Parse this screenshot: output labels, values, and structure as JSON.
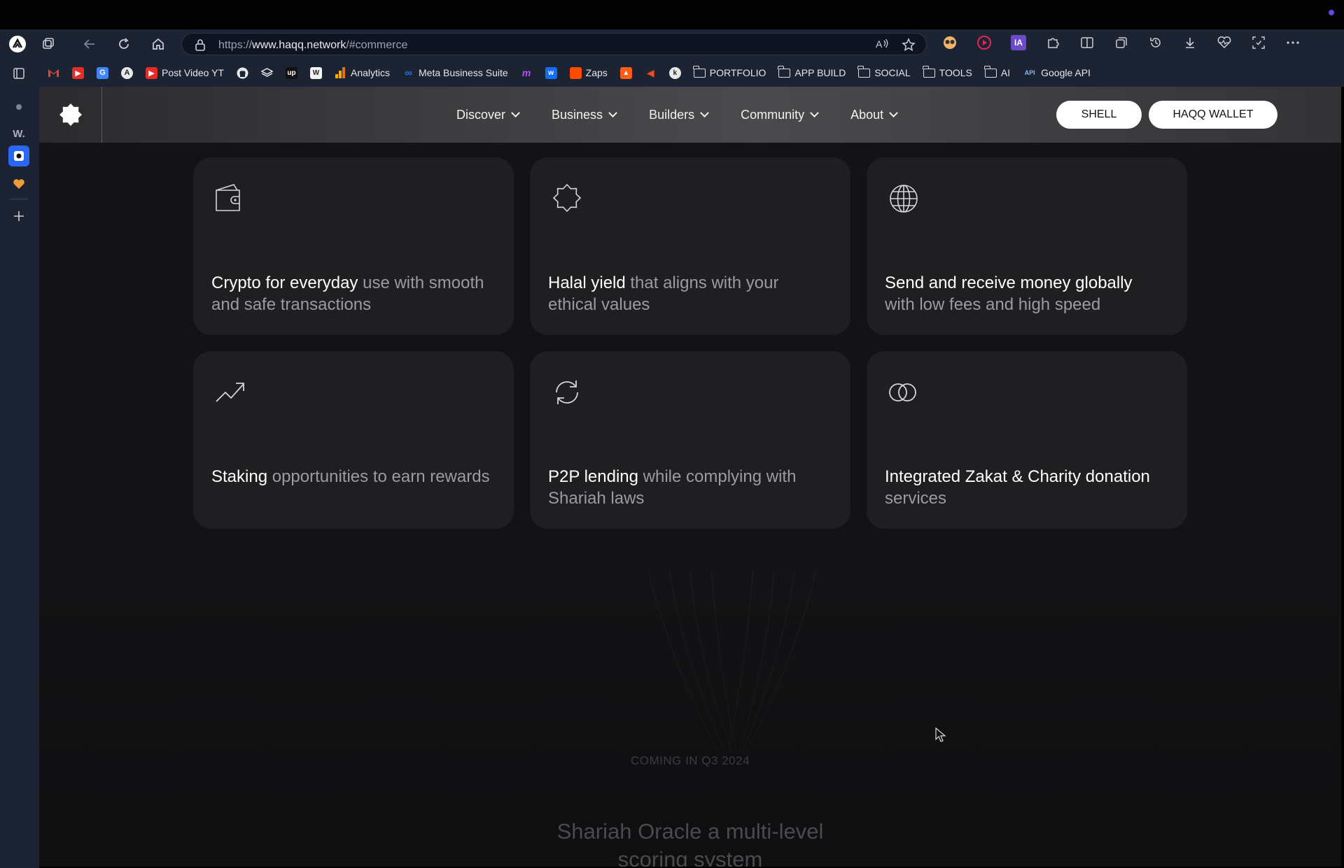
{
  "browser": {
    "url_prefix": "https://",
    "url_host": "www.haqq.network",
    "url_path": "/#commerce",
    "bookmarks": [
      {
        "label": "",
        "icon": "gmail-icon"
      },
      {
        "label": "",
        "icon": "youtube-icon"
      },
      {
        "label": "",
        "icon": "google-ads-icon"
      },
      {
        "label": "",
        "icon": "arc-icon"
      },
      {
        "label": "Post Video YT",
        "icon": "youtube-icon"
      },
      {
        "label": "",
        "icon": "github-icon"
      },
      {
        "label": "",
        "icon": "stack-icon"
      },
      {
        "label": "",
        "icon": "upwork-icon"
      },
      {
        "label": "",
        "icon": "w-icon"
      },
      {
        "label": "Analytics",
        "icon": "analytics-icon"
      },
      {
        "label": "Meta Business Suite",
        "icon": "meta-icon"
      },
      {
        "label": "",
        "icon": "make-icon"
      },
      {
        "label": "",
        "icon": "webflow-icon"
      },
      {
        "label": "Zaps",
        "icon": "zapier-icon"
      },
      {
        "label": "",
        "icon": "hostinger-icon"
      },
      {
        "label": "",
        "icon": "elementor-icon"
      },
      {
        "label": "",
        "icon": "plugin-icon"
      },
      {
        "label": "PORTFOLIO",
        "icon": "folder-icon"
      },
      {
        "label": "APP BUILD",
        "icon": "folder-icon"
      },
      {
        "label": "SOCIAL",
        "icon": "folder-icon"
      },
      {
        "label": "TOOLS",
        "icon": "folder-icon"
      },
      {
        "label": "AI",
        "icon": "folder-icon"
      },
      {
        "label": "Google API",
        "icon": "api-icon"
      }
    ],
    "sidebar": {
      "w_label": "W."
    }
  },
  "site": {
    "nav": [
      {
        "label": "Discover"
      },
      {
        "label": "Business"
      },
      {
        "label": "Builders"
      },
      {
        "label": "Community"
      },
      {
        "label": "About"
      }
    ],
    "shell_button": "SHELL",
    "wallet_button": "HAQQ WALLET"
  },
  "features": [
    {
      "highlight": "Crypto for everyday",
      "rest": " use with smooth and safe transactions",
      "icon": "wallet-icon"
    },
    {
      "highlight": "Halal yield",
      "rest": " that aligns with your ethical values",
      "icon": "octagram-icon"
    },
    {
      "highlight": "Send and receive money globally",
      "rest": " with low fees and high speed",
      "icon": "globe-icon"
    },
    {
      "highlight": "Staking",
      "rest": " opportunities to earn rewards",
      "icon": "trending-up-icon"
    },
    {
      "highlight": "P2P lending",
      "rest": " while complying with Shariah laws",
      "icon": "refresh-icon"
    },
    {
      "highlight": "Integrated Zakat & Charity donation",
      "rest": " services",
      "icon": "coins-icon"
    }
  ],
  "coming": {
    "label": "COMING IN Q3 2024",
    "title": "Shariah Oracle a multi-level scoring system"
  },
  "colors": {
    "page_bg": "#131315",
    "card_bg": "#1f1f22",
    "chrome_bg": "#1c2333",
    "accent_purple": "#5f4ce0"
  }
}
